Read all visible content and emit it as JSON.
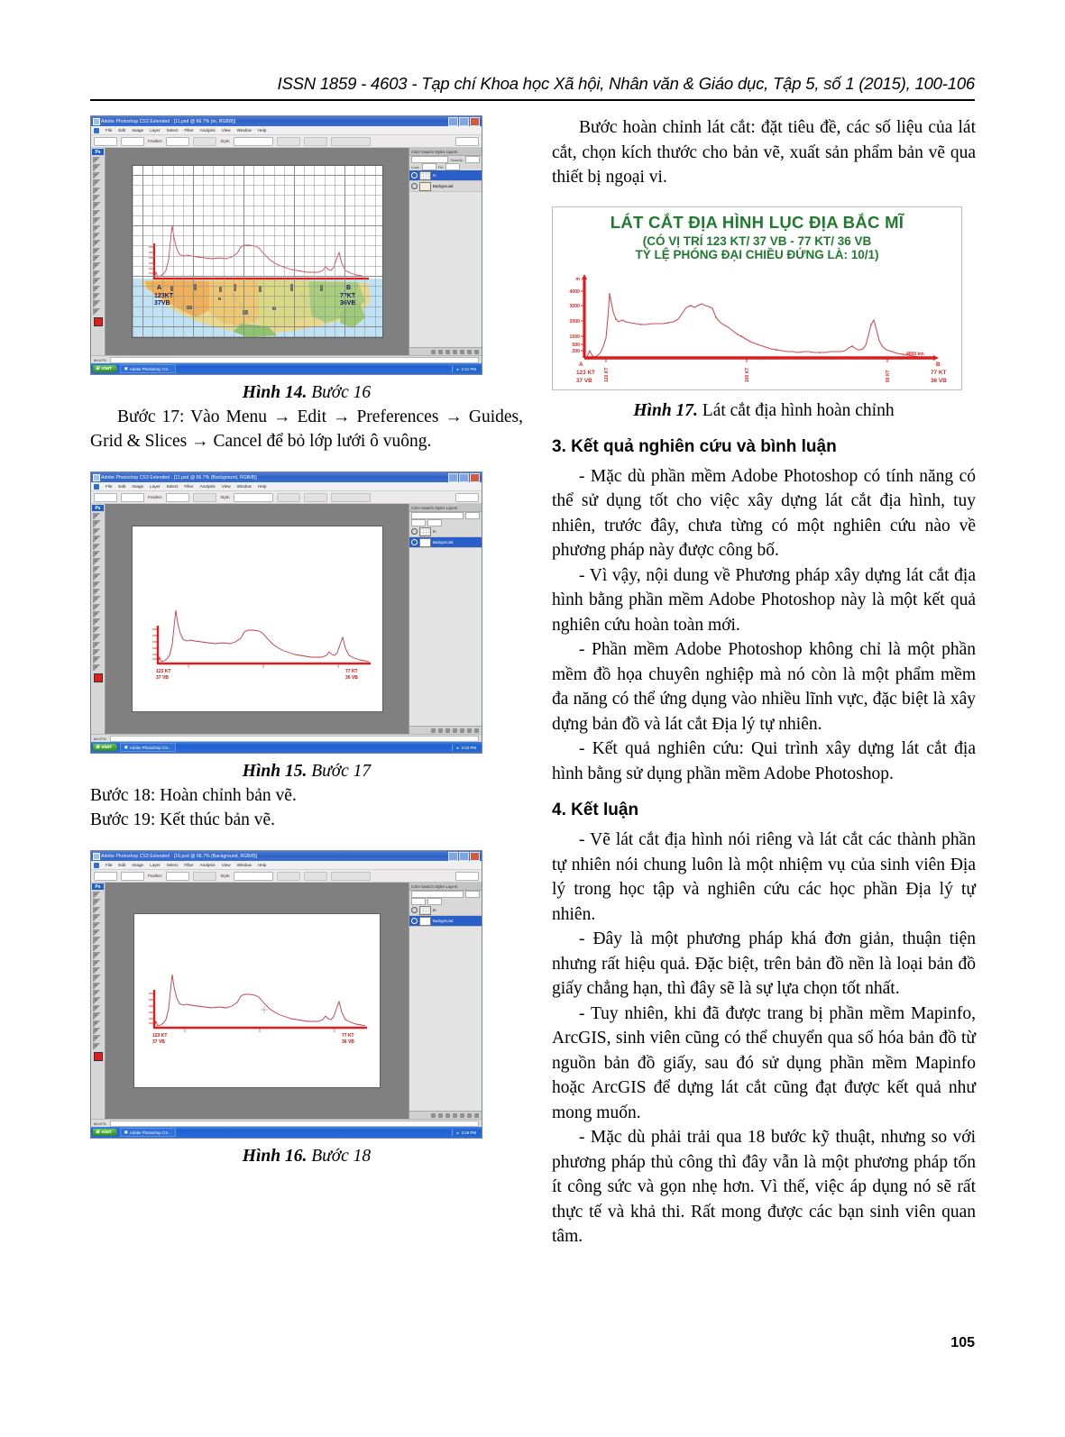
{
  "header": {
    "text": "ISSN 1859 - 4603 - Tạp chí Khoa học Xã hội, Nhân văn & Giáo dục, Tập 5, số 1 (2015), 100-106"
  },
  "page_number": "105",
  "left_column": {
    "figure14": {
      "caption_bold": "Hình 14.",
      "caption_italic": "Bước 16",
      "window": {
        "title": "Adobe Photoshop CS3 Extended - [11.psd @ 66.7% (m, RGB/8)]",
        "menus": [
          "File",
          "Edit",
          "Image",
          "Layer",
          "Select",
          "Filter",
          "Analysis",
          "View",
          "Window",
          "Help"
        ],
        "option_feather_label": "Feather:",
        "option_feather_value": "0 px",
        "option_antialias_label": "Anti-alias",
        "option_style_label": "Style:",
        "option_style_value": "Normal",
        "option_width_label": "Width:",
        "option_height_label": "Height:",
        "option_refine_label": "Refine Edge...",
        "workspace_label": "Workspace",
        "layers_tab": "Color  Swatch  Styles   Layers",
        "blend_mode": "Normal",
        "opacity_label": "Opacity:",
        "opacity_value": "100%",
        "lock_label": "Lock:",
        "fill_label": "Fill:",
        "fill_value": "100%",
        "layer_1": "m",
        "layer_2": "Background",
        "zoom_status": "66.67%",
        "doc_status": "Doc:",
        "taskbar_start": "start",
        "taskbar_item": "Adobe Photoshop CS...",
        "taskbar_clock": "2:41 PM"
      },
      "map_labels": {
        "a_point": "A",
        "a_lon": "123KT",
        "a_lat": "37VB",
        "b_point": "B",
        "b_lon": "77KT",
        "b_lat": "36VB"
      }
    },
    "step17_text": "Bước 17: Vào Menu → Edit → Preferences → Guides, Grid & Slices → Cancel để bỏ lớp lưới ô vuông.",
    "figure15": {
      "caption_bold": "Hình 15.",
      "caption_italic": "Bước 17",
      "window": {
        "title": "Adobe Photoshop CS3 Extended - [11.psd @ 66.7% (Background, RGB/8)]",
        "layer_1": "m",
        "layer_2": "Background",
        "taskbar_start": "start",
        "taskbar_item": "Adobe Photoshop CS...",
        "taskbar_clock": "2:42 PM"
      },
      "profile_labels": {
        "a_lon": "123 KT",
        "a_lat": "37 VB",
        "b_lon": "77 KT",
        "b_lat": "36 VB"
      }
    },
    "step18_text": "Bước 18: Hoàn chỉnh bản vẽ.",
    "step19_text": "Bước 19: Kết thúc bản vẽ.",
    "figure16": {
      "caption_bold": "Hình 16.",
      "caption_italic": "Bước 18",
      "window": {
        "title": "Adobe Photoshop CS3 Extended - [16.psd @ 66.7% (Background, RGB/8)]",
        "layer_1": "m",
        "layer_2": "Background",
        "taskbar_start": "start",
        "taskbar_item": "Adobe Photoshop CS...",
        "taskbar_clock": "3:26 PM"
      },
      "profile_labels": {
        "a_lon": "123 KT",
        "a_lat": "37 VB",
        "b_lon": "77 KT",
        "b_lat": "36 VB"
      }
    }
  },
  "right_column": {
    "intro_para": "Bước hoàn chỉnh lát cắt: đặt tiêu đề, các số liệu của lát cắt, chọn kích thước cho bản vẽ, xuất sản phẩm bản vẽ qua thiết bị ngoại vi.",
    "figure17": {
      "caption_bold": "Hình 17.",
      "caption_rest": "Lát cắt địa hình hoàn chỉnh"
    },
    "section3_heading": "3. Kết quả nghiên cứu và bình luận",
    "section3_paras": [
      "- Mặc dù phần mềm Adobe Photoshop có tính năng có thể sử dụng tốt cho việc xây dựng lát cắt địa hình, tuy nhiên, trước đây, chưa từng có một nghiên cứu nào về phương pháp này được công bố.",
      "- Vì vậy, nội dung về Phương pháp xây dựng lát cắt địa hình bằng phần mềm Adobe Photoshop này là một kết quả nghiên cứu hoàn toàn mới.",
      "- Phần mềm Adobe Photoshop không chỉ là một phần mềm đồ họa chuyên nghiệp mà nó còn là một phẩm mềm đa năng có thể ứng dụng vào nhiều lĩnh vực, đặc biệt là xây dựng bản đồ và lát cắt Địa lý tự nhiên.",
      "- Kết quả nghiên cứu: Qui trình xây dựng lát cắt địa hình bằng sử dụng phần mềm Adobe Photoshop."
    ],
    "section4_heading": "4. Kết luận",
    "section4_paras": [
      "- Vẽ lát cắt địa hình nói riêng và lát cắt các thành phần tự nhiên nói chung luôn là một nhiệm vụ của sinh viên Địa lý trong học tập và nghiên cứu các học phần Địa lý tự nhiên.",
      "- Đây là một phương pháp khá đơn giản, thuận tiện nhưng rất hiệu quả. Đặc biệt, trên bản đồ nền là loại bản đồ giấy chẳng hạn, thì đây sẽ là sự lựa chọn tốt nhất.",
      "- Tuy nhiên, khi đã được trang bị phần mềm Mapinfo, ArcGIS, sinh viên cũng có thể chuyển qua số hóa bản đồ từ nguồn bản đồ giấy, sau đó sử dụng phần mềm Mapinfo hoặc ArcGIS để dựng lát cắt cũng đạt được kết quả như mong muốn.",
      "- Mặc dù phải trải qua 18 bước kỹ thuật, nhưng so với phương pháp thủ công thì đây vẫn là một phương pháp tốn ít công sức và gọn nhẹ hơn. Vì thế, việc áp dụng nó sẽ rất thực tế và khả thi. Rất mong được các bạn sinh viên quan tâm."
    ]
  },
  "chart_data": {
    "type": "line",
    "title": "LÁT CẮT ĐỊA HÌNH LỤC ĐỊA BẮC MĨ",
    "subtitle_line1": "(CÓ VỊ TRÍ 123 KT/ 37 VB - 77 KT/ 36 VB",
    "subtitle_line2": "TỶ LỆ PHÓNG ĐẠI CHIỀU ĐỨNG LÀ: 10/1)",
    "title_color": "#1f7a2e",
    "line_color": "#d93a3a",
    "axis_color": "#e02020",
    "ylabel": "m",
    "yticks": [
      200,
      500,
      1000,
      2000,
      3000,
      4000
    ],
    "ylim": [
      0,
      4400
    ],
    "xlim": [
      0,
      4400
    ],
    "xunit": "km",
    "xticks": [
      {
        "value": 0,
        "label": "A",
        "sub1": "123 KT",
        "sub2": "37 VB"
      },
      {
        "value": 260,
        "label": "120 KT"
      },
      {
        "value": 1950,
        "label": "100 KT"
      },
      {
        "value": 3640,
        "label": "80 KT"
      },
      {
        "value": 4200,
        "label": "4000 km"
      },
      {
        "value": 4350,
        "label": "B",
        "sub1": "77 KT",
        "sub2": "36 VB"
      }
    ],
    "x": [
      0,
      40,
      80,
      120,
      160,
      200,
      240,
      280,
      310,
      330,
      350,
      380,
      410,
      450,
      500,
      560,
      620,
      700,
      780,
      860,
      940,
      1020,
      1100,
      1180,
      1260,
      1340,
      1400,
      1450,
      1500,
      1560,
      1620,
      1680,
      1740,
      1800,
      1860,
      1920,
      1980,
      2040,
      2100,
      2160,
      2220,
      2280,
      2340,
      2400,
      2470,
      2540,
      2620,
      2700,
      2800,
      2900,
      3000,
      3100,
      3200,
      3300,
      3400,
      3500,
      3560,
      3600,
      3640,
      3680,
      3720,
      3760,
      3800,
      3860,
      3920,
      4000,
      4080,
      4160,
      4260,
      4350
    ],
    "y": [
      0,
      60,
      420,
      120,
      90,
      140,
      260,
      700,
      2200,
      4250,
      3600,
      2600,
      2250,
      2150,
      2250,
      2150,
      2050,
      2000,
      1950,
      1900,
      1950,
      1920,
      1880,
      1900,
      1950,
      2000,
      2300,
      2900,
      3100,
      2950,
      3050,
      3150,
      3050,
      2980,
      2900,
      2350,
      2100,
      1950,
      1800,
      1650,
      1450,
      1280,
      1120,
      1000,
      880,
      760,
      650,
      560,
      470,
      400,
      340,
      300,
      260,
      240,
      230,
      280,
      420,
      650,
      620,
      420,
      380,
      400,
      700,
      1600,
      2150,
      1200,
      520,
      280,
      120,
      40
    ],
    "points_marked": true,
    "grid": false,
    "legend": null
  }
}
